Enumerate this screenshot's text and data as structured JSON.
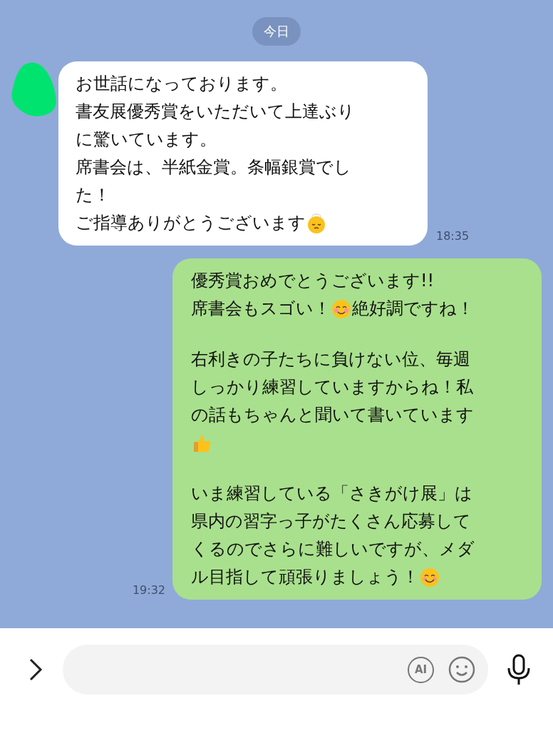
{
  "date_divider": "今日",
  "received_message": {
    "time": "18:35",
    "paragraphs": [
      [
        [
          {
            "kind": "text",
            "text": "お世話になっております。"
          }
        ],
        [
          {
            "kind": "text",
            "text": "書友展優秀賞をいただいて上達ぶり"
          }
        ],
        [
          {
            "kind": "text",
            "text": "に驚いています。"
          }
        ],
        [
          {
            "kind": "text",
            "text": "席書会は、半紙金賞。条幅銀賞でし"
          }
        ],
        [
          {
            "kind": "text",
            "text": "た！"
          }
        ],
        [
          {
            "kind": "text",
            "text": "ご指導ありがとうございます"
          },
          {
            "kind": "sleepy"
          }
        ]
      ]
    ]
  },
  "sent_message": {
    "time": "19:32",
    "paragraphs": [
      [
        [
          {
            "kind": "text",
            "text": "優秀賞おめでとうございます!!"
          }
        ],
        [
          {
            "kind": "text",
            "text": "席書会もスゴい！"
          },
          {
            "kind": "blush"
          },
          {
            "kind": "text",
            "text": "絶好調ですね！"
          }
        ]
      ],
      [
        [
          {
            "kind": "text",
            "text": "右利きの子たちに負けない位、毎週"
          }
        ],
        [
          {
            "kind": "text",
            "text": "しっかり練習していますからね！私"
          }
        ],
        [
          {
            "kind": "text",
            "text": "の話もちゃんと聞いて書いています"
          }
        ],
        [
          {
            "kind": "thumb"
          }
        ]
      ],
      [
        [
          {
            "kind": "text",
            "text": "いま練習している「さきがけ展」は"
          }
        ],
        [
          {
            "kind": "text",
            "text": "県内の習字っ子がたくさん応募して"
          }
        ],
        [
          {
            "kind": "text",
            "text": "くるのでさらに難しいですが、メダ"
          }
        ],
        [
          {
            "kind": "text",
            "text": "ル目指して頑張りましょう！"
          },
          {
            "kind": "smile"
          }
        ]
      ]
    ]
  },
  "composer": {
    "ai_label": "AI"
  }
}
